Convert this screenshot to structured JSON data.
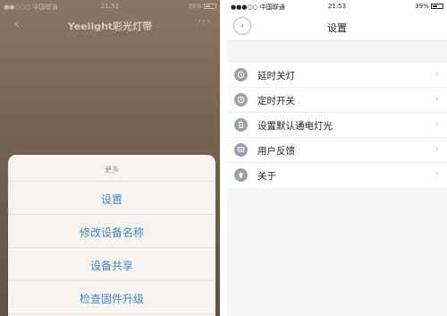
{
  "left": {
    "status": {
      "carrier": "●●○○○ 中国联通",
      "time": "21:52",
      "battery": "39%"
    },
    "nav": {
      "back": "‹",
      "title": "Yeelight彩光灯带",
      "more": "···"
    },
    "sheet": {
      "header": "更多",
      "items": [
        "设置",
        "修改设备名称",
        "设备共享",
        "检查固件升级"
      ]
    }
  },
  "right": {
    "status": {
      "carrier": "●●●○○ 中国联通",
      "time": "21:53",
      "battery": "39%"
    },
    "nav": {
      "back": "‹",
      "title": "设置"
    },
    "menu": [
      {
        "icon": "timer-off-icon",
        "label": "延时关灯"
      },
      {
        "icon": "clock-icon",
        "label": "定时开关"
      },
      {
        "icon": "power-default-icon",
        "label": "设置默认通电灯光"
      },
      {
        "icon": "feedback-icon",
        "label": "用户反馈"
      },
      {
        "icon": "about-icon",
        "label": "关于"
      }
    ]
  },
  "colors": {
    "sheet_text": "#3f86c8",
    "icon_gray": "#9aa0a8"
  }
}
